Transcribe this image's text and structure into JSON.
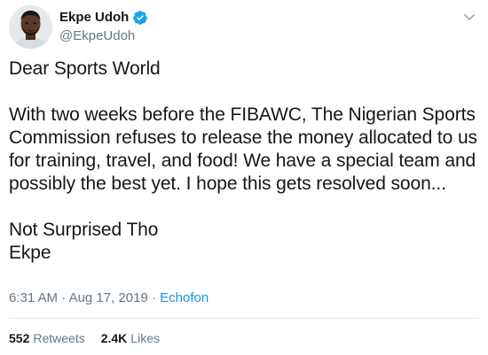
{
  "author": {
    "display_name": "Ekpe Udoh",
    "handle": "@EkpeUdoh",
    "verified": true,
    "avatar_icon": "profile-photo",
    "verified_icon": "verified-badge-icon",
    "verified_color": "#1da1f2"
  },
  "menu": {
    "icon": "chevron-down-icon"
  },
  "tweet": {
    "paragraphs": [
      "Dear Sports World",
      "With two weeks before the FIBAWC, The Nigerian Sports Commission refuses to release the money allocated to us for training, travel, and food! We have a special team and possibly the best yet. I hope this gets resolved soon...",
      "Not Surprised Tho\nEkpe"
    ]
  },
  "meta": {
    "time": "6:31 AM",
    "separator": " · ",
    "date": "Aug 17, 2019",
    "source": "Echofon"
  },
  "stats": {
    "retweets_count": "552",
    "retweets_label": "Retweets",
    "likes_count": "2.4K",
    "likes_label": "Likes"
  },
  "colors": {
    "text": "#14171a",
    "secondary": "#657786",
    "link": "#1b95e0",
    "divider": "#e1e8ed"
  }
}
